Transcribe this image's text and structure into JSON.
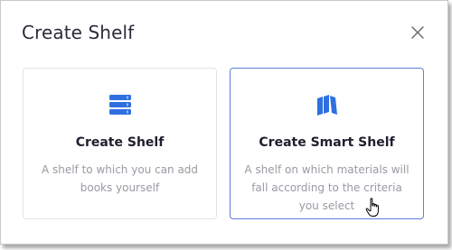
{
  "dialog": {
    "title": "Create Shelf",
    "close_icon": "close-icon"
  },
  "options": [
    {
      "icon": "books-stack-icon",
      "title": "Create Shelf",
      "description": "A shelf to which you can add books yourself"
    },
    {
      "icon": "smart-books-icon",
      "title": "Create Smart Shelf",
      "description": "A shelf on which materials will fall according to the criteria you select"
    }
  ],
  "colors": {
    "accent": "#2f6fe0",
    "selected_border": "#5b7fd6",
    "title_text": "#2b2b3a",
    "desc_text": "#9a9aa3"
  },
  "cursor_icon": "hand-pointer-icon"
}
